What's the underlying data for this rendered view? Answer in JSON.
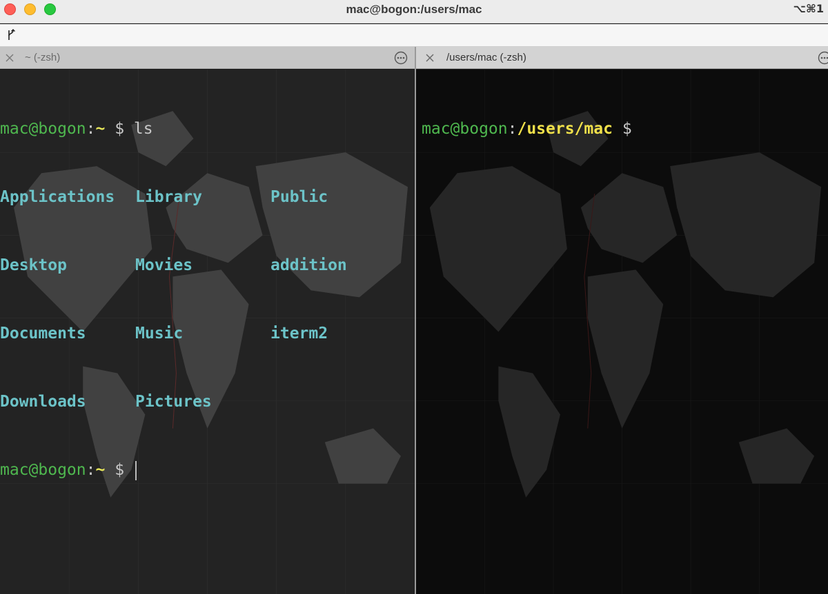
{
  "window": {
    "title": "mac@bogon:/users/mac",
    "shortcut": "⌥⌘1"
  },
  "toolbar": {
    "icons": [
      "branch-icon"
    ]
  },
  "panes": {
    "left": {
      "tab_title": "~ (-zsh)",
      "prompt1": {
        "user": "mac@bogon",
        "colon": ":",
        "path": "~",
        "dollar": " $ ",
        "command": "ls"
      },
      "ls_output": [
        [
          "Applications",
          "Library",
          "Public"
        ],
        [
          "Desktop",
          "Movies",
          "addition"
        ],
        [
          "Documents",
          "Music",
          "iterm2"
        ],
        [
          "Downloads",
          "Pictures",
          ""
        ]
      ],
      "prompt2": {
        "user": "mac@bogon",
        "colon": ":",
        "path": "~",
        "dollar": " $ "
      }
    },
    "right": {
      "tab_title": "/users/mac (-zsh)",
      "prompt1": {
        "user": "mac@bogon",
        "colon": ":",
        "path": "/users/mac",
        "dollar": " $"
      }
    }
  },
  "colors": {
    "prompt_user": "#4fb84f",
    "prompt_path": "#e6e65a",
    "directory": "#6cc3c8"
  }
}
